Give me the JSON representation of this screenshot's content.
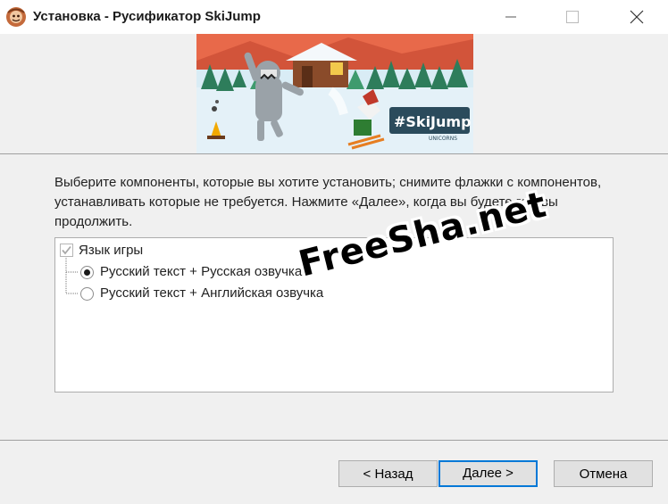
{
  "window": {
    "title": "Установка - Русификатор SkiJump",
    "controls": {
      "minimize_icon": "minimize-icon",
      "maximize_icon": "maximize-icon",
      "close_icon": "close-icon"
    }
  },
  "header": {
    "banner_logo_text": "#SkiJump",
    "banner_sub_text": "UNICORNS"
  },
  "main": {
    "description": "Выберите компоненты, которые вы хотите установить; снимите флажки с компонентов, устанавливать которые не требуется. Нажмите «Далее», когда вы будете готовы продолжить.",
    "components": {
      "group_label": "Язык игры",
      "group_checked": true,
      "options": [
        {
          "label": "Русский текст + Русская озвучка",
          "selected": true
        },
        {
          "label": "Русский текст + Английская озвучка",
          "selected": false
        }
      ]
    }
  },
  "watermark": "FreeSha.net",
  "footer": {
    "back_label": "< Назад",
    "next_label": "Далее >",
    "cancel_label": "Отмена"
  },
  "colors": {
    "accent": "#0078d7",
    "window_bg": "#f0f0f0"
  }
}
